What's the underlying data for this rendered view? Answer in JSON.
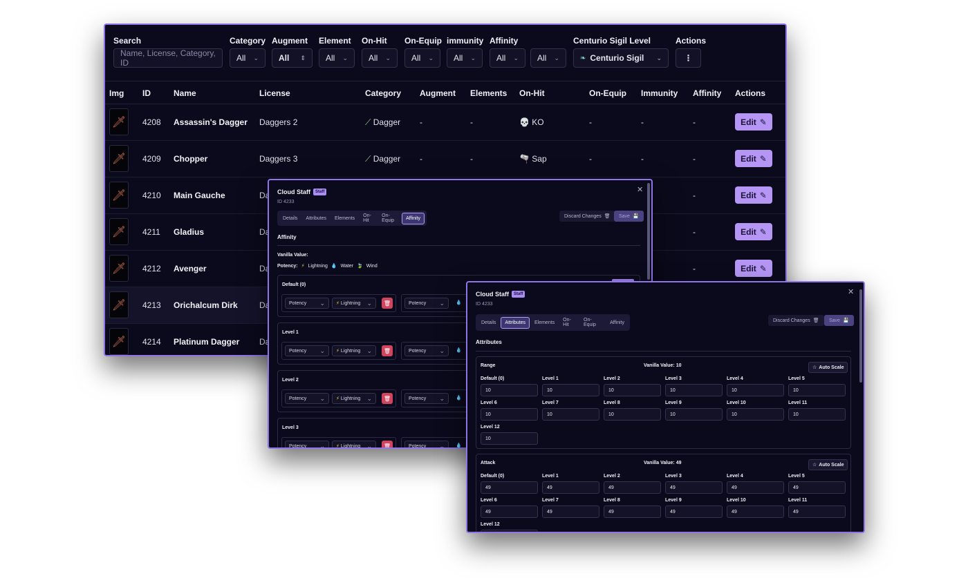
{
  "filters": {
    "search": {
      "label": "Search",
      "placeholder": "Name, License, Category, ID"
    },
    "category": {
      "label": "Category",
      "value": "All"
    },
    "augment": {
      "label": "Augment",
      "value": "All"
    },
    "element": {
      "label": "Element",
      "value": "All"
    },
    "onhit": {
      "label": "On-Hit",
      "value": "All"
    },
    "onequip": {
      "label": "On-Equip",
      "value": "All"
    },
    "immunity": {
      "label": "immunity",
      "value": "All"
    },
    "affinity": {
      "label": "Affinity",
      "value": "All",
      "value2": "All"
    },
    "sigil": {
      "label": "Centurio Sigil Level",
      "value": "Centurio Sigil"
    },
    "actions": {
      "label": "Actions",
      "icon": "more-vertical-icon"
    }
  },
  "table": {
    "headers": [
      "Img",
      "ID",
      "Name",
      "License",
      "Category",
      "Augment",
      "Elements",
      "On-Hit",
      "On-Equip",
      "Immunity",
      "Affinity",
      "Actions"
    ],
    "edit_label": "Edit",
    "rows": [
      {
        "id": "4208",
        "name": "Assassin's Dagger",
        "license": "Daggers 2",
        "category": "Dagger",
        "augment": "-",
        "elements": "-",
        "onhit": "KO",
        "onhit_icon": "💀",
        "onequip": "-",
        "immunity": "-",
        "affinity": "-"
      },
      {
        "id": "4209",
        "name": "Chopper",
        "license": "Daggers 3",
        "category": "Dagger",
        "augment": "-",
        "elements": "-",
        "onhit": "Sap",
        "onhit_icon": "🫗",
        "onequip": "-",
        "immunity": "-",
        "affinity": "-"
      },
      {
        "id": "4210",
        "name": "Main Gauche",
        "license": "Da",
        "affinity": "-"
      },
      {
        "id": "4211",
        "name": "Gladius",
        "license": "Da",
        "affinity": "-"
      },
      {
        "id": "4212",
        "name": "Avenger",
        "license": "Da",
        "affinity": "-"
      },
      {
        "id": "4213",
        "name": "Orichalcum Dirk",
        "license": "Da"
      },
      {
        "id": "4214",
        "name": "Platinum Dagger",
        "license": "Da"
      }
    ]
  },
  "dialog_affinity": {
    "title": "Cloud Staff",
    "badge": "Staff",
    "id_text": "ID 4233",
    "tabs": [
      "Details",
      "Attributes",
      "Elements",
      "On-Hit",
      "On-Equip",
      "Affinity"
    ],
    "active_tab": "Affinity",
    "discard_label": "Discard Changes",
    "save_label": "Save",
    "section": "Affinity",
    "vanilla_label": "Vanilla Value:",
    "potency_label": "Potency:",
    "potency_items": [
      "Lightning",
      "Water",
      "Wind"
    ],
    "levels": [
      "Default (0)",
      "Level 1",
      "Level 2",
      "Level 3"
    ],
    "select_potency": "Potency",
    "select_lightning": "Lightning"
  },
  "dialog_attributes": {
    "title": "Cloud Staff",
    "badge": "Staff",
    "id_text": "ID 4233",
    "tabs": [
      "Details",
      "Attributes",
      "Elements",
      "On-Hit",
      "On-Equip",
      "Affinity"
    ],
    "active_tab": "Attributes",
    "discard_label": "Discard Changes",
    "save_label": "Save",
    "section": "Attributes",
    "auto_scale_label": "Auto Scale",
    "level_labels": [
      "Default (0)",
      "Level 1",
      "Level 2",
      "Level 3",
      "Level 4",
      "Level 5",
      "Level 6",
      "Level 7",
      "Level 8",
      "Level 9",
      "Level 10",
      "Level 11",
      "Level 12"
    ],
    "range": {
      "name": "Range",
      "vanilla": "Vanilla Value: 10",
      "values": [
        "10",
        "10",
        "10",
        "10",
        "10",
        "10",
        "10",
        "10",
        "10",
        "10",
        "10",
        "10",
        "10"
      ]
    },
    "attack": {
      "name": "Attack",
      "vanilla": "Vanilla Value: 49",
      "values": [
        "49",
        "49",
        "49",
        "49",
        "49",
        "49",
        "49",
        "49",
        "49",
        "49",
        "49",
        "49"
      ]
    }
  }
}
